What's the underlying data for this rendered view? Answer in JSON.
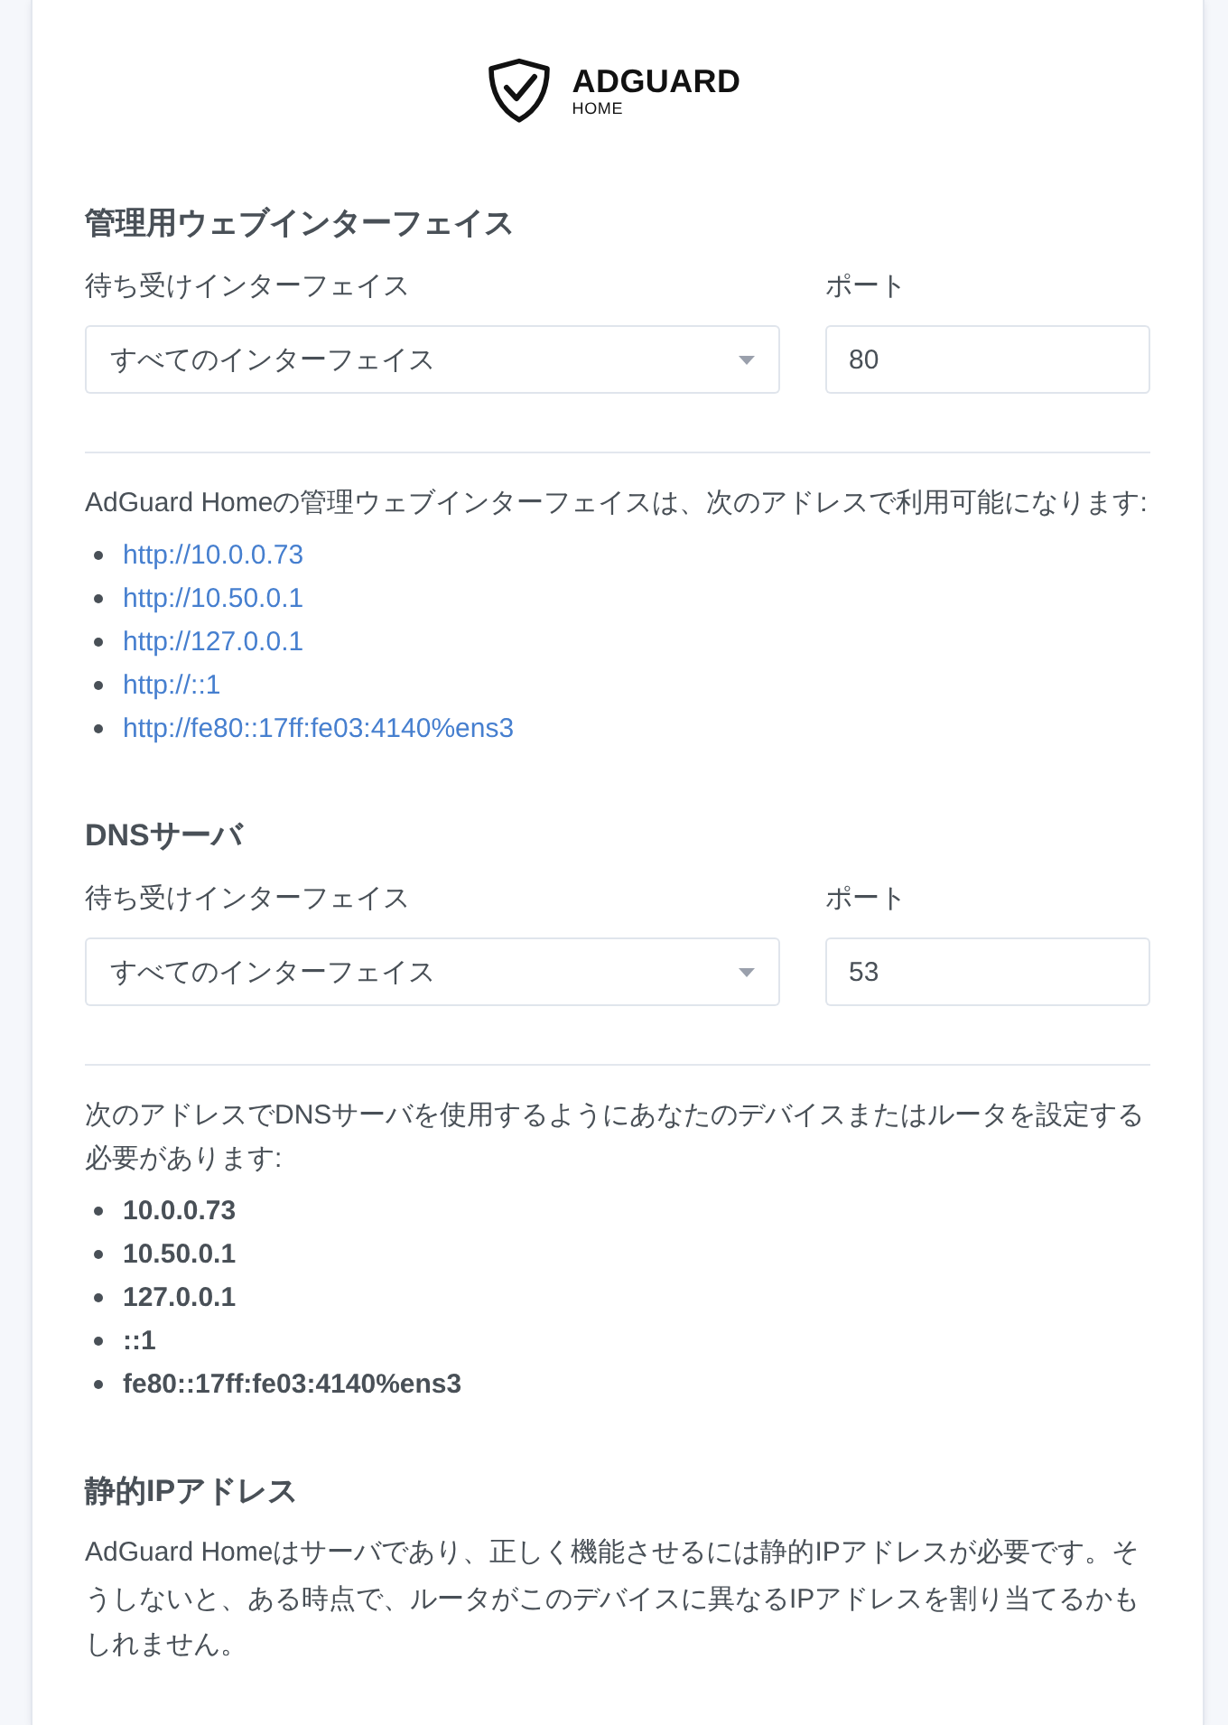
{
  "logo": {
    "title": "ADGUARD",
    "subtitle": "HOME"
  },
  "sections": [
    {
      "kind": "interface",
      "title": "管理用ウェブインターフェイス",
      "interface": {
        "label": "待ち受けインターフェイス",
        "value": "すべてのインターフェイス"
      },
      "port": {
        "label": "ポート",
        "value": "80"
      },
      "note": "AdGuard Homeの管理ウェブインターフェイスは、次のアドレスで利用可能になります:",
      "addresses": [
        {
          "kind": "link",
          "text": "http://10.0.0.73"
        },
        {
          "kind": "link",
          "text": "http://10.50.0.1"
        },
        {
          "kind": "link",
          "text": "http://127.0.0.1"
        },
        {
          "kind": "link",
          "text": "http://::1"
        },
        {
          "kind": "link",
          "text": "http://fe80::17ff:fe03:4140%ens3"
        }
      ]
    },
    {
      "kind": "interface",
      "title": "DNSサーバ",
      "interface": {
        "label": "待ち受けインターフェイス",
        "value": "すべてのインターフェイス"
      },
      "port": {
        "label": "ポート",
        "value": "53"
      },
      "note": "次のアドレスでDNSサーバを使用するようにあなたのデバイスまたはルータを設定する必要があります:",
      "addresses": [
        {
          "kind": "bold",
          "text": "10.0.0.73"
        },
        {
          "kind": "bold",
          "text": "10.50.0.1"
        },
        {
          "kind": "bold",
          "text": "127.0.0.1"
        },
        {
          "kind": "bold",
          "text": "::1"
        },
        {
          "kind": "bold",
          "text": "fe80::17ff:fe03:4140%ens3"
        }
      ]
    },
    {
      "kind": "static",
      "title": "静的IPアドレス",
      "note": "AdGuard Homeはサーバであり、正しく機能させるには静的IPアドレスが必要です。そうしないと、ある時点で、ルータがこのデバイスに異なるIPアドレスを割り当てるかもしれません。"
    }
  ]
}
